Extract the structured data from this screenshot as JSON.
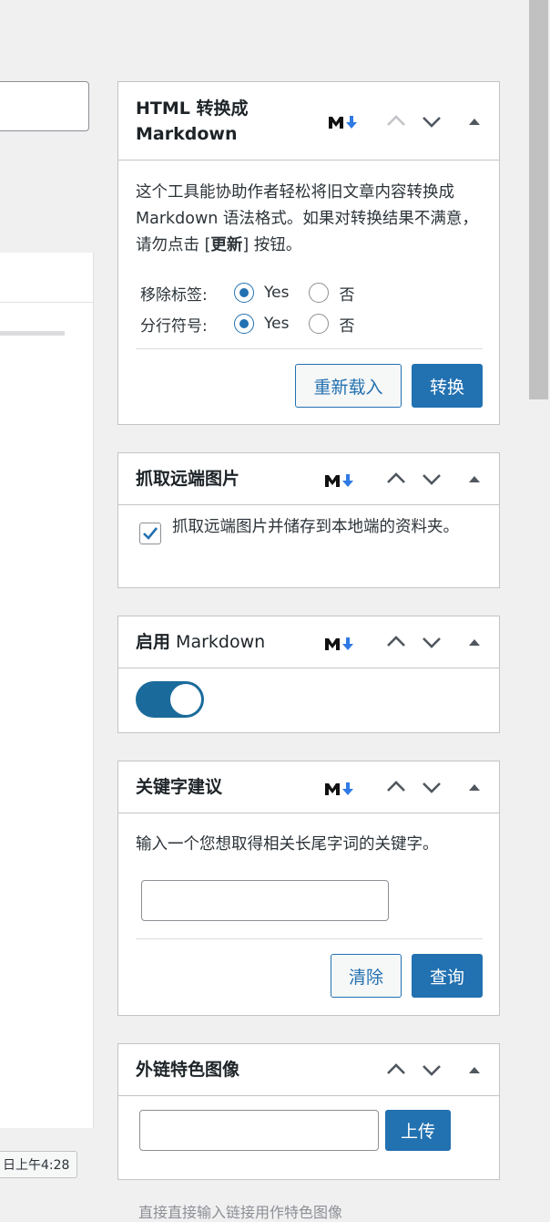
{
  "left": {
    "timestamp": "日上午4:28"
  },
  "html_to_md": {
    "title_line1": "HTML 转换成",
    "title_line2": "Markdown",
    "description_parts": {
      "a": "这个工具能协助作者轻松将旧文章内容转换成 Markdown 语法格式。如果对转换结果不满意，请勿点击 ",
      "bracket_open": "[",
      "strong": "更新",
      "bracket_close": "]",
      "b": " 按钮。"
    },
    "rows": [
      {
        "label": "移除标签:",
        "yes": "Yes",
        "no": "否",
        "selected": "yes"
      },
      {
        "label": "分行符号:",
        "yes": "Yes",
        "no": "否",
        "selected": "yes"
      }
    ],
    "reload_button": "重新载入",
    "convert_button": "转换"
  },
  "fetch_images": {
    "title": "抓取远端图片",
    "checkbox_label": "抓取远端图片并储存到本地端的资料夹。",
    "checked": true
  },
  "enable_markdown": {
    "title_bold": "启用",
    "title_rest": " Markdown",
    "enabled": true
  },
  "keyword": {
    "title": "关键字建议",
    "description": "输入一个您想取得相关长尾字词的关键字。",
    "input_value": "",
    "clear_button": "清除",
    "query_button": "查询"
  },
  "featured_image": {
    "title": "外链特色图像",
    "upload_button": "上传",
    "hint": "直接直接输入链接用作特色图像"
  },
  "colors": {
    "primary": "#2271b1",
    "toggle_on": "#1a6b9b",
    "border": "#c3c4c7"
  },
  "icons": [
    "markdown-icon",
    "chevron-up-icon",
    "chevron-down-icon",
    "triangle-up-icon",
    "checkmark-icon"
  ]
}
